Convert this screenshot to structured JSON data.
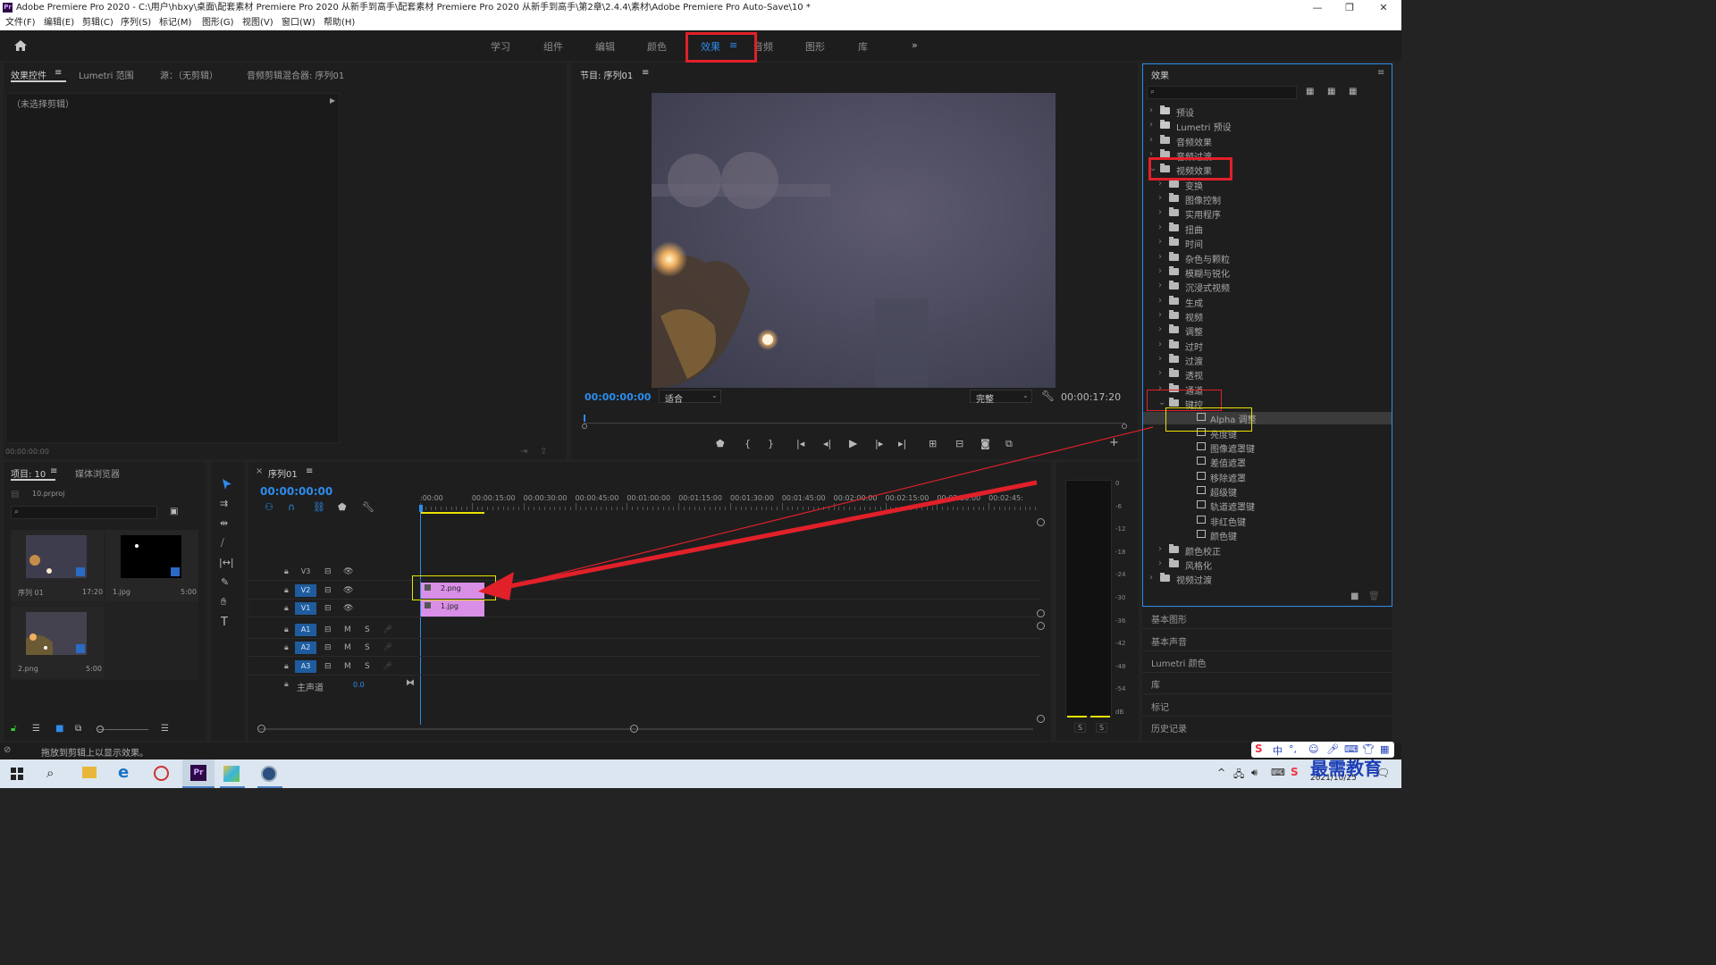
{
  "window": {
    "title": "Adobe Premiere Pro 2020 - C:\\用户\\hbxy\\桌面\\配套素材 Premiere Pro 2020 从新手到高手\\配套素材 Premiere Pro 2020 从新手到高手\\第2章\\2.4.4\\素材\\Adobe Premiere Pro Auto-Save\\10 *",
    "minimize": "—",
    "restore": "❐",
    "close": "✕"
  },
  "menu": [
    "文件(F)",
    "编辑(E)",
    "剪辑(C)",
    "序列(S)",
    "标记(M)",
    "图形(G)",
    "视图(V)",
    "窗口(W)",
    "帮助(H)"
  ],
  "workspaces": [
    "学习",
    "组件",
    "编辑",
    "颜色",
    "效果",
    "音频",
    "图形",
    "库"
  ],
  "workspace_active": "效果",
  "workspace_more": "»",
  "source_panel": {
    "tabs": [
      "效果控件",
      "Lumetri 范围",
      "源：（无剪辑）",
      "音频剪辑混合器: 序列01"
    ],
    "no_clip": "（未选择剪辑）",
    "timecode": "00:00:00:00"
  },
  "program": {
    "title": "节目: 序列01",
    "timecode": "00:00:00:00",
    "fit": "适合",
    "quality": "完整",
    "duration": "00:00:17:20"
  },
  "effects": {
    "title": "效果",
    "items": [
      {
        "label": "预设",
        "level": 0,
        "kind": "fxfolder",
        "open": false
      },
      {
        "label": "Lumetri 预设",
        "level": 0,
        "kind": "fxfolder",
        "open": false
      },
      {
        "label": "音频效果",
        "level": 0,
        "kind": "folder",
        "open": false
      },
      {
        "label": "音频过渡",
        "level": 0,
        "kind": "folder",
        "open": false
      },
      {
        "label": "视频效果",
        "level": 0,
        "kind": "folder",
        "open": true
      },
      {
        "label": "变换",
        "level": 1,
        "kind": "folder",
        "open": false
      },
      {
        "label": "图像控制",
        "level": 1,
        "kind": "folder",
        "open": false
      },
      {
        "label": "实用程序",
        "level": 1,
        "kind": "folder",
        "open": false
      },
      {
        "label": "扭曲",
        "level": 1,
        "kind": "folder",
        "open": false
      },
      {
        "label": "时间",
        "level": 1,
        "kind": "folder",
        "open": false
      },
      {
        "label": "杂色与颗粒",
        "level": 1,
        "kind": "folder",
        "open": false
      },
      {
        "label": "模糊与锐化",
        "level": 1,
        "kind": "folder",
        "open": false
      },
      {
        "label": "沉浸式视频",
        "level": 1,
        "kind": "folder",
        "open": false
      },
      {
        "label": "生成",
        "level": 1,
        "kind": "folder",
        "open": false
      },
      {
        "label": "视频",
        "level": 1,
        "kind": "folder",
        "open": false
      },
      {
        "label": "调整",
        "level": 1,
        "kind": "folder",
        "open": false
      },
      {
        "label": "过时",
        "level": 1,
        "kind": "folder",
        "open": false
      },
      {
        "label": "过渡",
        "level": 1,
        "kind": "folder",
        "open": false
      },
      {
        "label": "透视",
        "level": 1,
        "kind": "folder",
        "open": false
      },
      {
        "label": "通道",
        "level": 1,
        "kind": "folder",
        "open": false
      },
      {
        "label": "键控",
        "level": 1,
        "kind": "folder",
        "open": true
      },
      {
        "label": "Alpha 调整",
        "level": 2,
        "kind": "fx",
        "open": false
      },
      {
        "label": "亮度键",
        "level": 2,
        "kind": "fx",
        "open": false
      },
      {
        "label": "图像遮罩键",
        "level": 2,
        "kind": "fx",
        "open": false
      },
      {
        "label": "差值遮罩",
        "level": 2,
        "kind": "fx",
        "open": false
      },
      {
        "label": "移除遮罩",
        "level": 2,
        "kind": "fx",
        "open": false
      },
      {
        "label": "超级键",
        "level": 2,
        "kind": "fx",
        "open": false
      },
      {
        "label": "轨道遮罩键",
        "level": 2,
        "kind": "fx",
        "open": false
      },
      {
        "label": "非红色键",
        "level": 2,
        "kind": "fx",
        "open": false
      },
      {
        "label": "颜色键",
        "level": 2,
        "kind": "fx",
        "open": false
      },
      {
        "label": "颜色校正",
        "level": 1,
        "kind": "folder",
        "open": false
      },
      {
        "label": "风格化",
        "level": 1,
        "kind": "folder",
        "open": false
      },
      {
        "label": "视频过渡",
        "level": 0,
        "kind": "folder",
        "open": false
      }
    ],
    "other_panels": [
      "基本图形",
      "基本声音",
      "Lumetri 颜色",
      "库",
      "标记",
      "历史记录"
    ]
  },
  "project": {
    "tabs": [
      "项目: 10",
      "媒体浏览器"
    ],
    "file": "10.prproj",
    "bins": [
      {
        "name": "序列 01",
        "dur": "17:20"
      },
      {
        "name": "1.jpg",
        "dur": "5:00"
      },
      {
        "name": "2.png",
        "dur": "5:00"
      }
    ]
  },
  "timeline": {
    "tab": "序列01",
    "timecode": "00:00:00:00",
    "ruler": [
      ":00:00",
      "00:00:15:00",
      "00:00:30:00",
      "00:00:45:00",
      "00:01:00:00",
      "00:01:15:00",
      "00:01:30:00",
      "00:01:45:00",
      "00:02:00:00",
      "00:02:15:00",
      "00:02:30:00",
      "00:02:45:"
    ],
    "tracks": [
      {
        "name": "V3"
      },
      {
        "name": "V2"
      },
      {
        "name": "V1"
      },
      {
        "name": "A1"
      },
      {
        "name": "A2"
      },
      {
        "name": "A3"
      }
    ],
    "master": "主声道",
    "master_val": "0.0",
    "clips": [
      {
        "name": "2.png",
        "track": "V2"
      },
      {
        "name": "1.jpg",
        "track": "V1"
      }
    ],
    "m": "M",
    "s": "S"
  },
  "meter": {
    "scale": [
      "0",
      "-6",
      "-12",
      "-18",
      "-24",
      "-30",
      "-36",
      "-42",
      "-48",
      "-54",
      "dB"
    ],
    "s": "S"
  },
  "status": "拖放到剪辑上以显示效果。",
  "tray": {
    "date": "2021/10/25",
    "watermark": "最需教育",
    "ime": "中"
  },
  "colors": {
    "accent": "#2d8ceb",
    "red": "#e1202a",
    "yellow": "#e9e200",
    "clip": "#d98fe6"
  }
}
